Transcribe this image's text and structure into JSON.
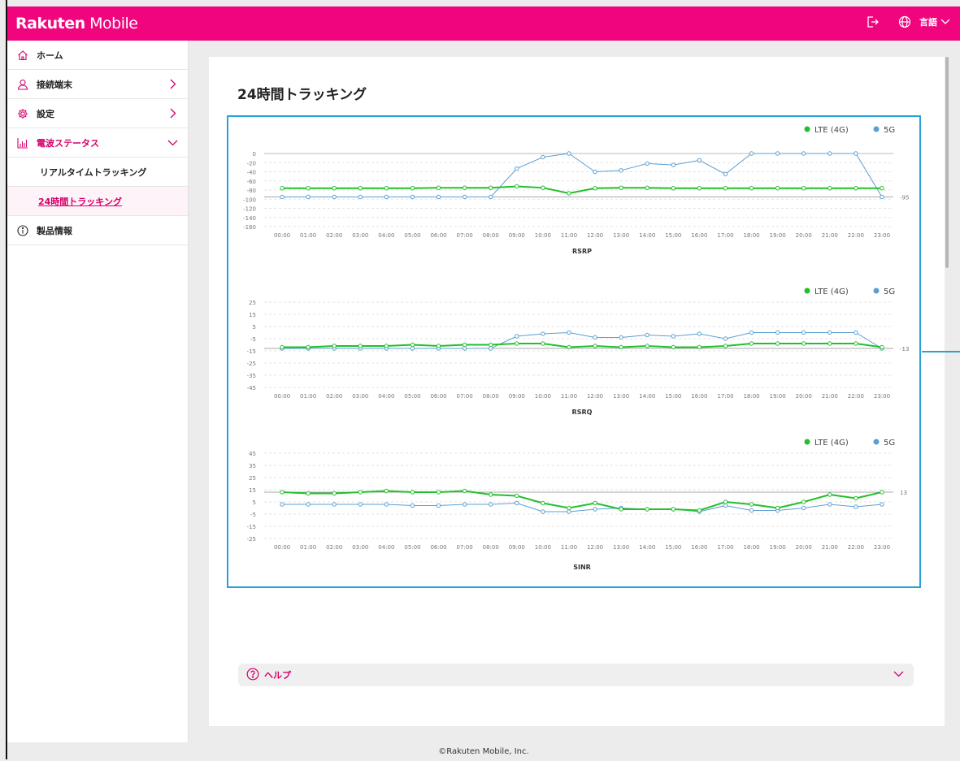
{
  "header": {
    "logo_bold": "Rakuten",
    "logo_rest": " Mobile",
    "language_label": "言語",
    "icons": [
      "logout-icon",
      "globe-icon",
      "chevron-down-icon"
    ]
  },
  "sidebar": {
    "items": [
      {
        "label": "ホーム",
        "icon": "home-icon"
      },
      {
        "label": "接続端末",
        "icon": "person-icon"
      },
      {
        "label": "設定",
        "icon": "gear-icon"
      },
      {
        "label": "電波ステータス",
        "icon": "bar-chart-icon"
      },
      {
        "label": "リアルタイムトラッキング"
      },
      {
        "label": "24時間トラッキング"
      },
      {
        "label": "製品情報",
        "icon": "info-icon"
      }
    ]
  },
  "main": {
    "title": "24時間トラッキング"
  },
  "help": {
    "label": "ヘルプ"
  },
  "footer": {
    "copyright": "©Rakuten Mobile, Inc."
  },
  "colors": {
    "brand": "#f0057f",
    "accent_text": "#d4006a",
    "lte": "#22c02a",
    "fiveg": "#5b9fd2",
    "chart_border": "#2aa0d8"
  },
  "chart_data": [
    {
      "type": "line",
      "xlabel": "RSRP",
      "categories": [
        "00:00",
        "01:00",
        "02:00",
        "03:00",
        "04:00",
        "05:00",
        "06:00",
        "07:00",
        "08:00",
        "09:00",
        "10:00",
        "11:00",
        "12:00",
        "13:00",
        "14:00",
        "15:00",
        "16:00",
        "17:00",
        "18:00",
        "19:00",
        "20:00",
        "21:00",
        "22:00",
        "23:00"
      ],
      "yticks": [
        0,
        -20,
        -40,
        -60,
        -80,
        -100,
        -120,
        -140,
        -160
      ],
      "ylim": [
        -160,
        0
      ],
      "reference": {
        "value": -95,
        "label": "-95"
      },
      "legend": [
        "LTE (4G)",
        "5G"
      ],
      "legend_position": "top-right",
      "series": [
        {
          "name": "LTE (4G)",
          "values": [
            -76,
            -76,
            -76,
            -76,
            -76,
            -76,
            -75,
            -75,
            -75,
            -72,
            -75,
            -87,
            -76,
            -75,
            -75,
            -76,
            -76,
            -76,
            -76,
            -76,
            -76,
            -76,
            -76,
            -76
          ]
        },
        {
          "name": "5G",
          "values": [
            -95,
            -95,
            -95,
            -95,
            -95,
            -95,
            -95,
            -95,
            -95,
            -33,
            -8,
            0,
            -40,
            -37,
            -22,
            -25,
            -15,
            -45,
            0,
            0,
            0,
            0,
            0,
            -95
          ]
        }
      ]
    },
    {
      "type": "line",
      "xlabel": "RSRQ",
      "categories": [
        "00:00",
        "01:00",
        "02:00",
        "03:00",
        "04:00",
        "05:00",
        "06:00",
        "07:00",
        "08:00",
        "09:00",
        "10:00",
        "11:00",
        "12:00",
        "13:00",
        "14:00",
        "15:00",
        "16:00",
        "17:00",
        "18:00",
        "19:00",
        "20:00",
        "21:00",
        "22:00",
        "23:00"
      ],
      "yticks": [
        25,
        15,
        5,
        -5,
        -15,
        -25,
        -35,
        -45
      ],
      "ylim": [
        -45,
        25
      ],
      "reference": {
        "value": -13,
        "label": "-13"
      },
      "legend": [
        "LTE (4G)",
        "5G"
      ],
      "legend_position": "top-right",
      "series": [
        {
          "name": "LTE (4G)",
          "values": [
            -12,
            -12,
            -11,
            -11,
            -11,
            -10,
            -11,
            -10,
            -10,
            -9,
            -9,
            -12,
            -11,
            -12,
            -11,
            -12,
            -12,
            -11,
            -9,
            -9,
            -9,
            -9,
            -9,
            -12
          ]
        },
        {
          "name": "5G",
          "values": [
            -13,
            -13,
            -13,
            -13,
            -13,
            -13,
            -13,
            -13,
            -13,
            -3,
            -1,
            0,
            -4,
            -4,
            -2,
            -3,
            -1,
            -5,
            0,
            0,
            0,
            0,
            0,
            -13
          ]
        }
      ]
    },
    {
      "type": "line",
      "xlabel": "SINR",
      "categories": [
        "00:00",
        "01:00",
        "02:00",
        "03:00",
        "04:00",
        "05:00",
        "06:00",
        "07:00",
        "08:00",
        "09:00",
        "10:00",
        "11:00",
        "12:00",
        "13:00",
        "14:00",
        "15:00",
        "16:00",
        "17:00",
        "18:00",
        "19:00",
        "20:00",
        "21:00",
        "22:00",
        "23:00"
      ],
      "yticks": [
        45,
        35,
        25,
        15,
        5,
        -5,
        -15,
        -25
      ],
      "ylim": [
        -25,
        45
      ],
      "reference": {
        "value": 13,
        "label": "13"
      },
      "legend": [
        "LTE (4G)",
        "5G"
      ],
      "legend_position": "top-right",
      "series": [
        {
          "name": "LTE (4G)",
          "values": [
            13,
            12,
            12,
            13,
            14,
            13,
            13,
            14,
            11,
            10,
            4,
            0,
            4,
            -1,
            -1,
            -1,
            -2,
            5,
            3,
            0,
            5,
            11,
            8,
            13
          ]
        },
        {
          "name": "5G",
          "values": [
            3,
            3,
            3,
            3,
            3,
            2,
            2,
            3,
            3,
            4,
            -3,
            -3,
            -1,
            0,
            -1,
            -1,
            -3,
            2,
            -2,
            -2,
            0,
            3,
            1,
            3
          ]
        }
      ]
    }
  ]
}
